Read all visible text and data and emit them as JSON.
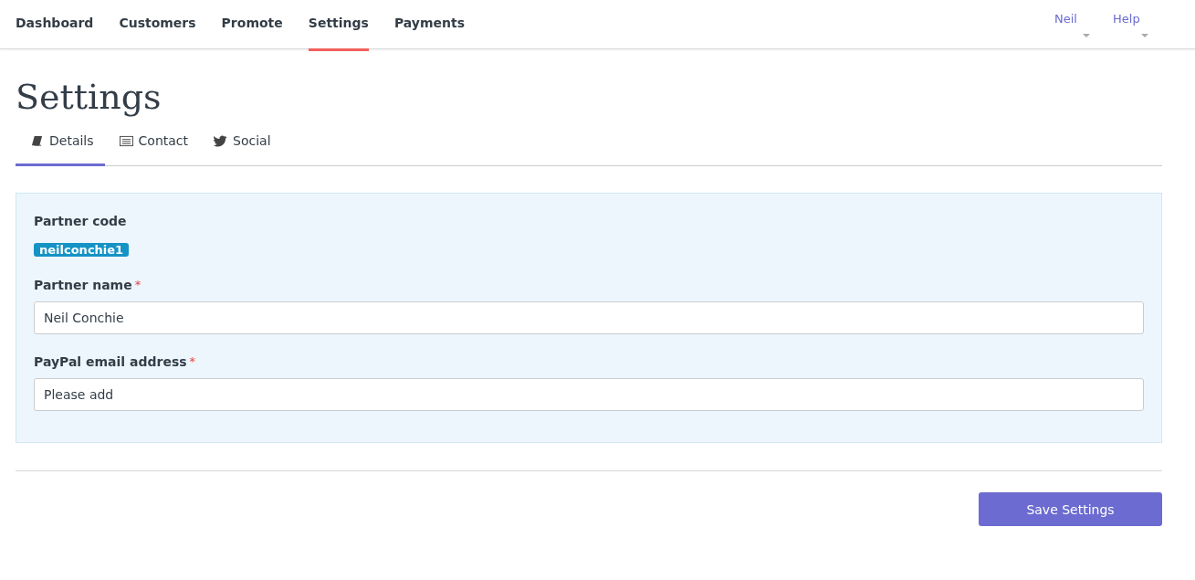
{
  "nav": {
    "items": [
      {
        "label": "Dashboard",
        "selected": false
      },
      {
        "label": "Customers",
        "selected": false
      },
      {
        "label": "Promote",
        "selected": false
      },
      {
        "label": "Settings",
        "selected": true
      },
      {
        "label": "Payments",
        "selected": false
      }
    ],
    "menus": [
      {
        "label": "Neil"
      },
      {
        "label": "Help"
      }
    ]
  },
  "page_title": "Settings",
  "tabs": [
    {
      "label": "Details",
      "selected": true
    },
    {
      "label": "Contact",
      "selected": false
    },
    {
      "label": "Social",
      "selected": false
    }
  ],
  "form": {
    "code_label": "Partner code",
    "code_value": "neilconchie1",
    "fields": [
      {
        "label": "Partner name",
        "required_mark": "*",
        "value": "Neil Conchie"
      },
      {
        "label": "PayPal email address",
        "required_mark": "*",
        "value": "Please add"
      }
    ]
  },
  "save_button": "Save Settings"
}
